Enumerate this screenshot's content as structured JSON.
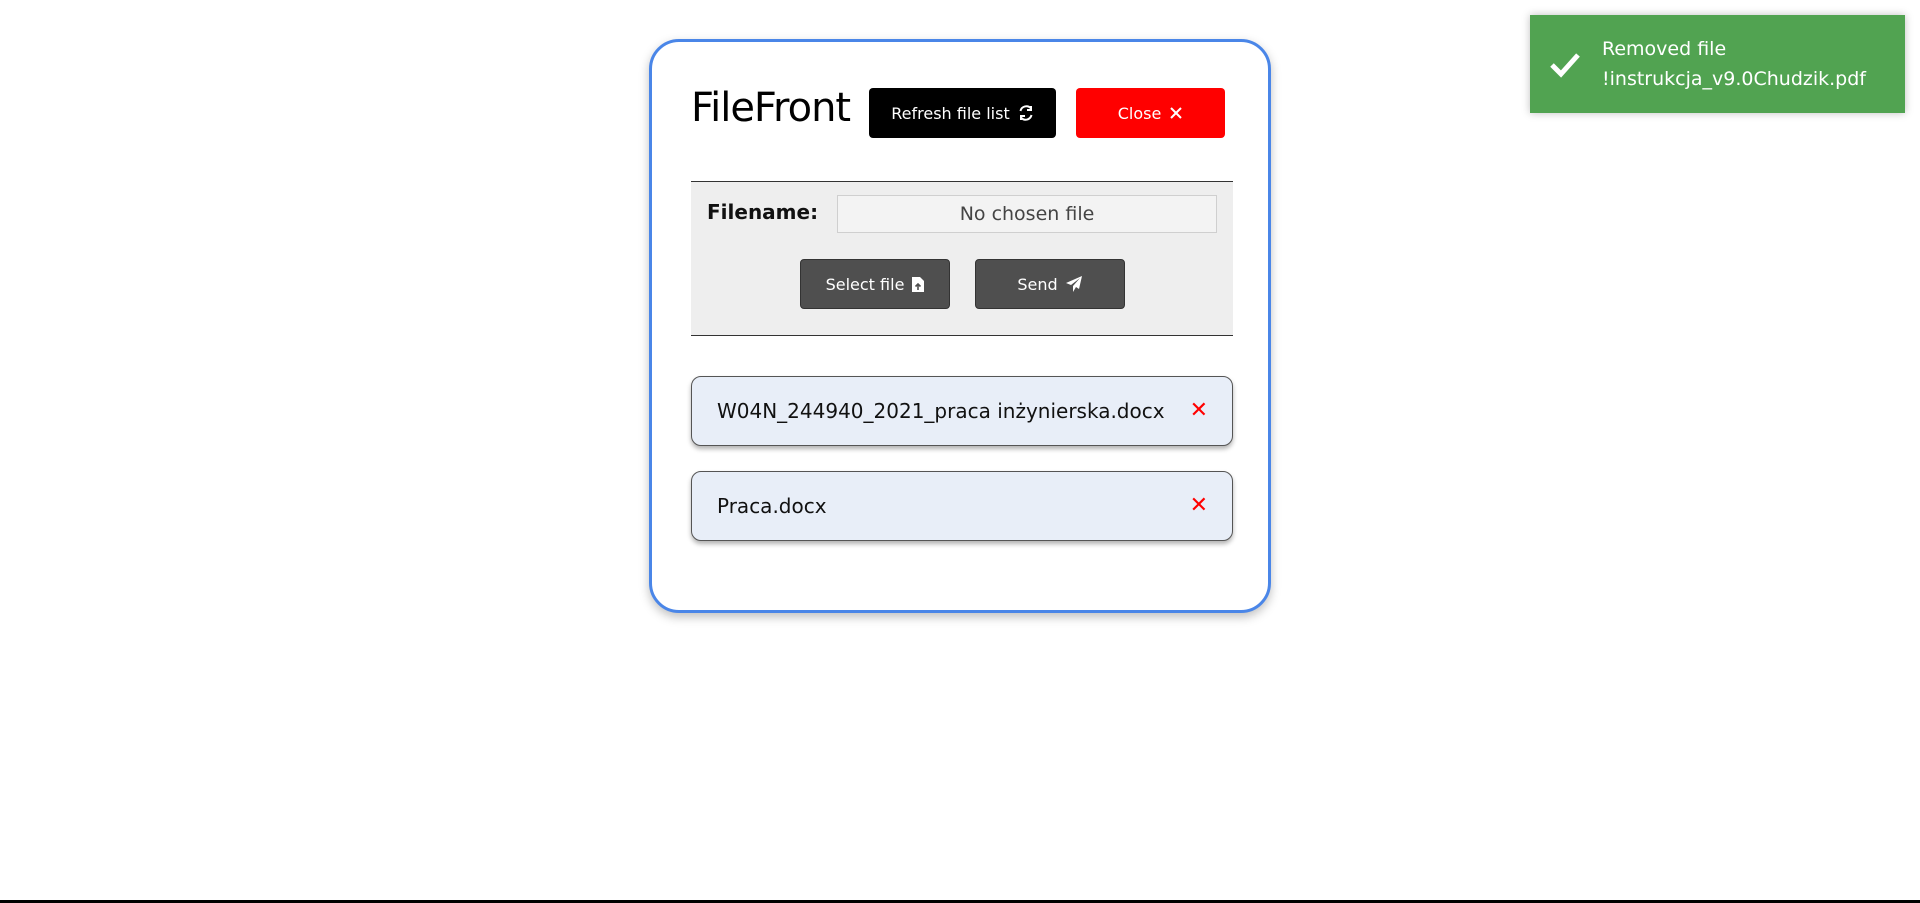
{
  "app": {
    "title": "FileFront"
  },
  "toolbar": {
    "refresh_label": "Refresh file list",
    "refresh_icon": "refresh-icon",
    "close_label": "Close",
    "close_icon": "close-icon"
  },
  "upload": {
    "filename_label": "Filename:",
    "filename_value": "No chosen file",
    "select_label": "Select file",
    "select_icon": "file-upload-icon",
    "send_label": "Send",
    "send_icon": "paper-plane-icon"
  },
  "files": [
    {
      "name": "W04N_244940_2021_praca inżynierska.docx",
      "remove_icon": "remove-icon"
    },
    {
      "name": "Praca.docx",
      "remove_icon": "remove-icon"
    }
  ],
  "toast": {
    "message": "Removed file\n!instrukcja_v9.0Chudzik.pdf",
    "icon": "checkmark-icon",
    "color": "#51a351"
  },
  "colors": {
    "accent": "#4a86e8",
    "close": "#ff0000",
    "refresh": "#000000",
    "neutral_button": "#4f4f4f"
  }
}
